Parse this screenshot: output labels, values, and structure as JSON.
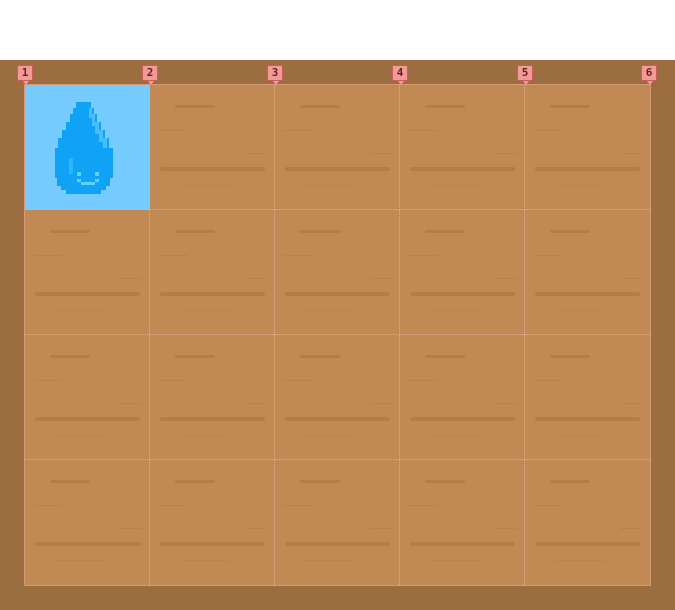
{
  "board": {
    "columns": 5,
    "rows": 4,
    "column_markers": [
      "1",
      "2",
      "3",
      "4",
      "5",
      "6"
    ],
    "colors": {
      "frame": "#9c6e3f",
      "tile": "#c18a55",
      "water_tile": "#76ccff",
      "marker": "#f29a9a"
    },
    "pieces": [
      {
        "type": "water-droplet",
        "column": 1,
        "row": 1,
        "icon": "water-droplet-icon"
      }
    ]
  }
}
